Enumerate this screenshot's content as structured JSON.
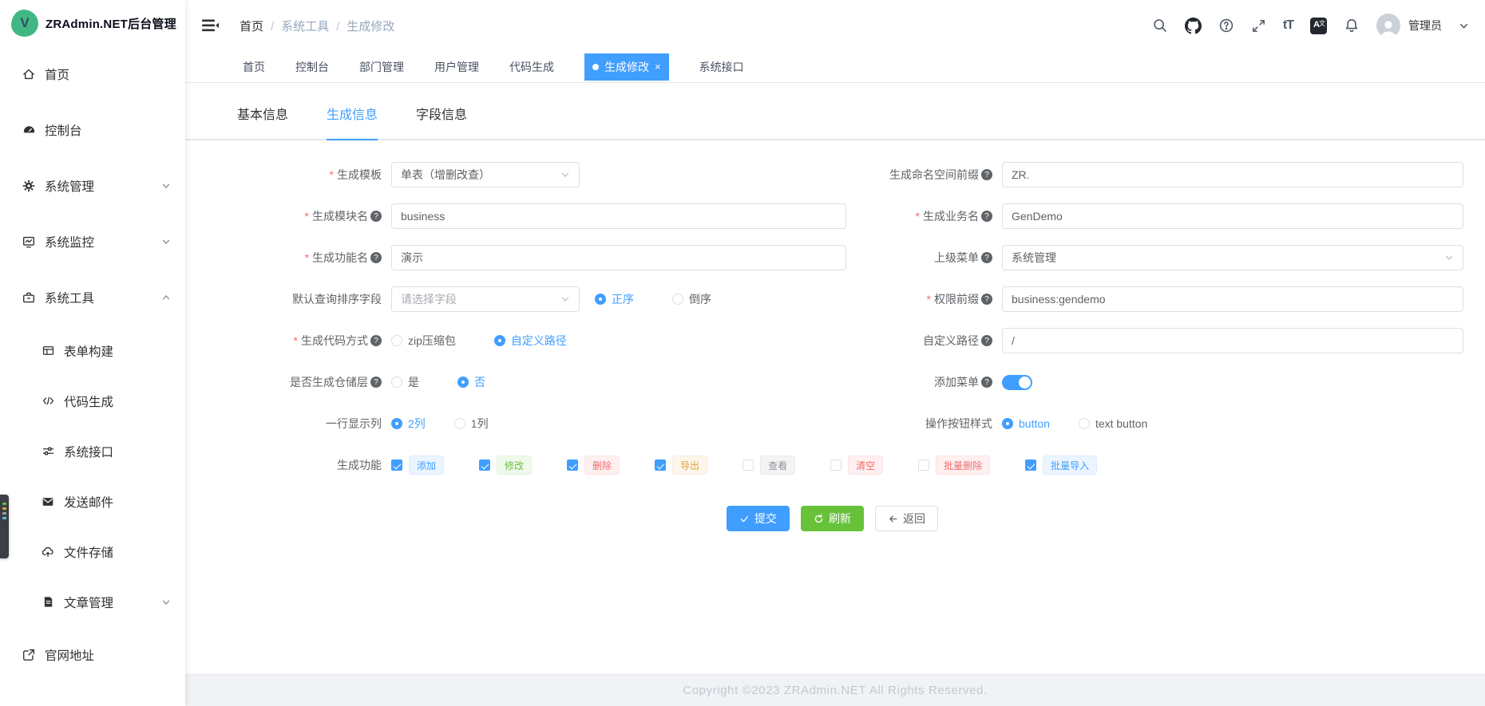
{
  "colors": {
    "primary": "#409eff",
    "success": "#67c23a",
    "danger": "#f56c6c",
    "warning": "#e6a23c",
    "info": "#909399",
    "logo_green": "#41b883"
  },
  "app": {
    "title": "ZRAdmin.NET后台管理",
    "logo_letter": "V"
  },
  "sidebar": {
    "items": [
      {
        "label": "首页",
        "icon": "home-icon"
      },
      {
        "label": "控制台",
        "icon": "dashboard-icon"
      },
      {
        "label": "系统管理",
        "icon": "gear-icon",
        "arrow": "down"
      },
      {
        "label": "系统监控",
        "icon": "monitor-icon",
        "arrow": "down"
      },
      {
        "label": "系统工具",
        "icon": "toolbox-icon",
        "arrow": "up",
        "expanded": true
      },
      {
        "label": "表单构建",
        "icon": "form-icon"
      },
      {
        "label": "代码生成",
        "icon": "code-icon"
      },
      {
        "label": "系统接口",
        "icon": "sliders-icon"
      },
      {
        "label": "发送邮件",
        "icon": "mail-icon"
      },
      {
        "label": "文件存储",
        "icon": "cloud-upload-icon"
      },
      {
        "label": "文章管理",
        "icon": "article-icon",
        "arrow": "down"
      },
      {
        "label": "官网地址",
        "icon": "external-link-icon"
      }
    ]
  },
  "navbar": {
    "breadcrumb": [
      "首页",
      "系统工具",
      "生成修改"
    ],
    "user": "管理员"
  },
  "tags": {
    "items": [
      "首页",
      "控制台",
      "部门管理",
      "用户管理",
      "代码生成",
      "生成修改",
      "系统接口"
    ],
    "active": "生成修改"
  },
  "form_tabs": [
    {
      "label": "基本信息",
      "active": false
    },
    {
      "label": "生成信息",
      "active": true
    },
    {
      "label": "字段信息",
      "active": false
    }
  ],
  "form": {
    "gen_template": {
      "label": "生成模板",
      "required": true,
      "value": "单表（增删改查）"
    },
    "namespace_prefix": {
      "label": "生成命名空间前缀",
      "value": "ZR."
    },
    "module_name": {
      "label": "生成模块名",
      "required": true,
      "value": "business"
    },
    "business_name": {
      "label": "生成业务名",
      "required": true,
      "value": "GenDemo"
    },
    "function_name": {
      "label": "生成功能名",
      "required": true,
      "value": "演示"
    },
    "parent_menu": {
      "label": "上级菜单",
      "value": "系统管理"
    },
    "sort_field": {
      "label": "默认查询排序字段",
      "placeholder": "请选择字段",
      "asc": "正序",
      "desc": "倒序",
      "selected": "正序"
    },
    "perm_prefix": {
      "label": "权限前缀",
      "required": true,
      "value": "business:gendemo"
    },
    "gen_type": {
      "label": "生成代码方式",
      "required": true,
      "opt_zip": "zip压缩包",
      "opt_path": "自定义路径",
      "selected": "自定义路径"
    },
    "custom_path": {
      "label": "自定义路径",
      "value": "/"
    },
    "repo_layer": {
      "label": "是否生成仓储层",
      "opt_yes": "是",
      "opt_no": "否",
      "selected": "否"
    },
    "add_menu": {
      "label": "添加菜单",
      "on": true
    },
    "row_cols": {
      "label": "一行显示列",
      "opt_2": "2列",
      "opt_1": "1列",
      "selected": "2列"
    },
    "btn_style": {
      "label": "操作按钮样式",
      "opt_button": "button",
      "opt_text": "text button",
      "selected": "button"
    },
    "gen_functions": {
      "label": "生成功能",
      "items": [
        {
          "label": "添加",
          "checked": true,
          "color": "blue"
        },
        {
          "label": "修改",
          "checked": true,
          "color": "green"
        },
        {
          "label": "删除",
          "checked": true,
          "color": "red"
        },
        {
          "label": "导出",
          "checked": true,
          "color": "orange"
        },
        {
          "label": "查看",
          "checked": false,
          "color": "gray"
        },
        {
          "label": "清空",
          "checked": false,
          "color": "red"
        },
        {
          "label": "批量删除",
          "checked": false,
          "color": "red"
        },
        {
          "label": "批量导入",
          "checked": true,
          "color": "blue"
        }
      ]
    },
    "buttons": {
      "submit": "提交",
      "refresh": "刷新",
      "back": "返回"
    }
  },
  "footer": {
    "copyright": "Copyright ©2023 ZRAdmin.NET All Rights Reserved."
  }
}
